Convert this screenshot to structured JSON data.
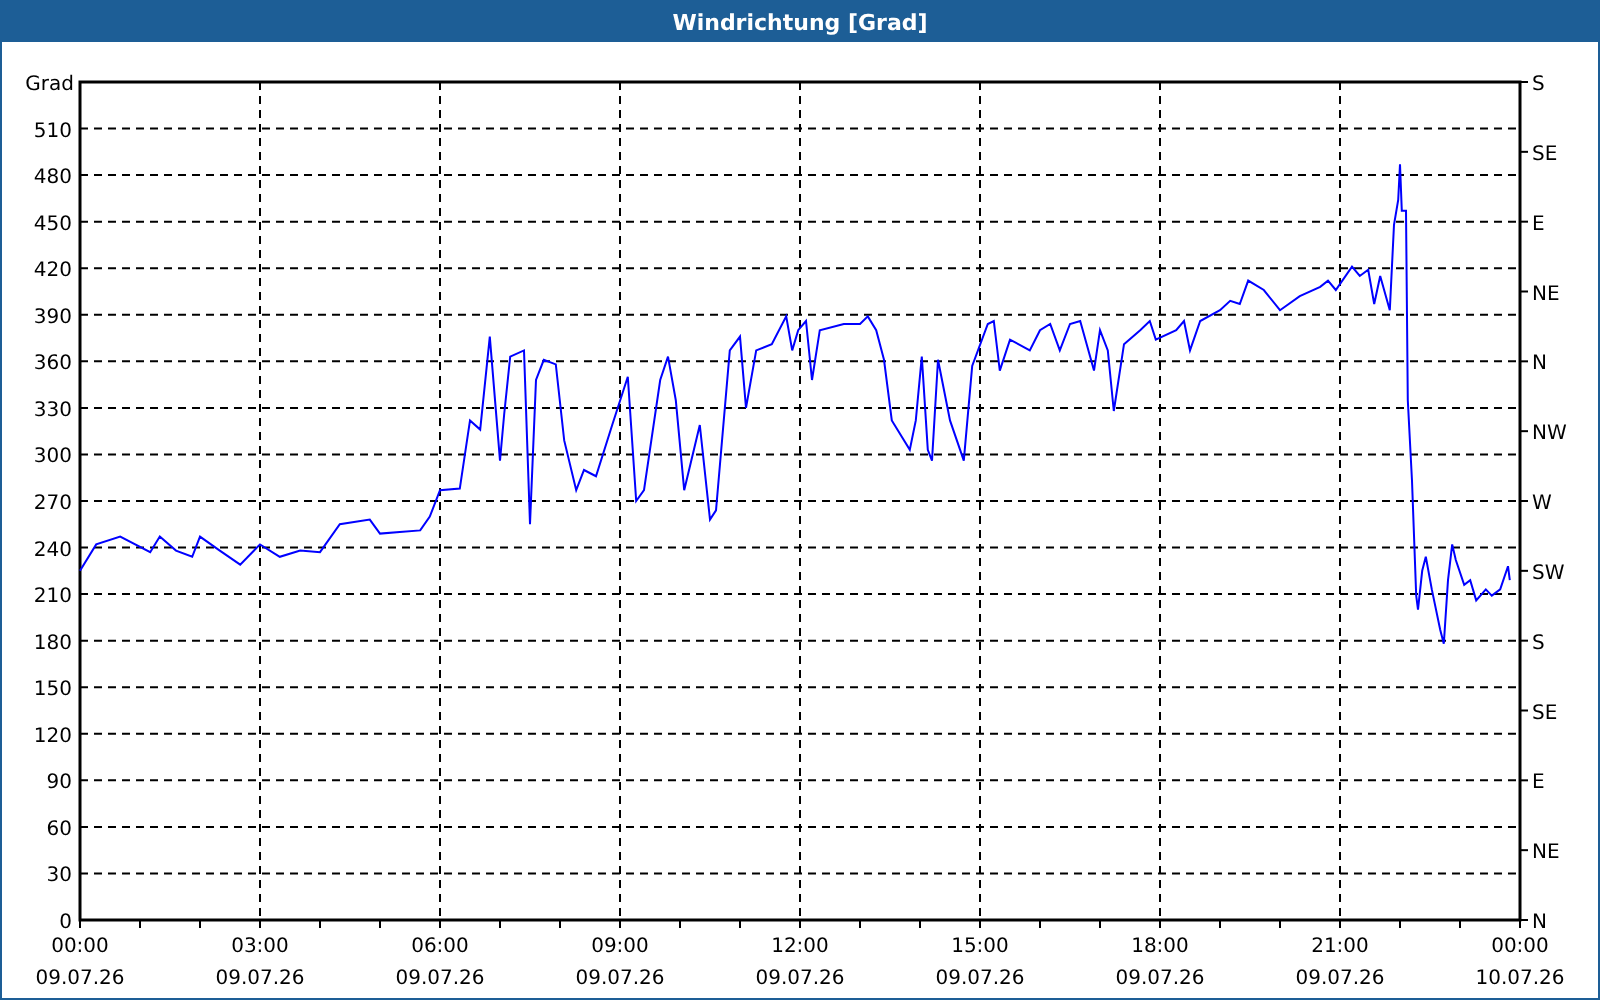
{
  "window": {
    "title": "Windrichtung [Grad]"
  },
  "chart": {
    "chart_data": {
      "type": "line",
      "grid": true,
      "ylabel": "Grad",
      "xlim": [
        0,
        24
      ],
      "ylim": [
        0,
        540
      ],
      "xticks": [
        {
          "value": 0,
          "label": "00:00"
        },
        {
          "value": 3,
          "label": "03:00"
        },
        {
          "value": 6,
          "label": "06:00"
        },
        {
          "value": 9,
          "label": "09:00"
        },
        {
          "value": 12,
          "label": "12:00"
        },
        {
          "value": 15,
          "label": "15:00"
        },
        {
          "value": 18,
          "label": "18:00"
        },
        {
          "value": 21,
          "label": "21:00"
        },
        {
          "value": 24,
          "label": "00:00"
        }
      ],
      "yticks": [
        0,
        30,
        60,
        90,
        120,
        150,
        180,
        210,
        240,
        270,
        300,
        330,
        360,
        390,
        420,
        450,
        480,
        510
      ],
      "x": [
        0,
        0.27,
        0.67,
        1.17,
        1.33,
        1.6,
        1.87,
        2.0,
        2.33,
        2.67,
        3.0,
        3.33,
        3.67,
        4.0,
        4.33,
        4.83,
        5.0,
        5.33,
        5.67,
        5.83,
        6.0,
        6.33,
        6.5,
        6.67,
        6.83,
        7.0,
        7.07,
        7.17,
        7.4,
        7.5,
        7.6,
        7.73,
        7.93,
        8.07,
        8.27,
        8.4,
        8.6,
        8.87,
        9.13,
        9.27,
        9.4,
        9.67,
        9.8,
        9.93,
        10.07,
        10.33,
        10.5,
        10.6,
        10.83,
        11.0,
        11.1,
        11.27,
        11.53,
        11.77,
        11.87,
        11.97,
        12.1,
        12.2,
        12.33,
        12.73,
        13.0,
        13.13,
        13.27,
        13.4,
        13.53,
        13.83,
        13.93,
        14.03,
        14.13,
        14.2,
        14.3,
        14.5,
        14.73,
        14.87,
        15.13,
        15.23,
        15.33,
        15.5,
        15.83,
        16.0,
        16.17,
        16.33,
        16.5,
        16.67,
        16.9,
        17.0,
        17.13,
        17.23,
        17.4,
        17.67,
        17.83,
        17.93,
        18.27,
        18.4,
        18.5,
        18.67,
        19.0,
        19.17,
        19.33,
        19.47,
        19.73,
        20.0,
        20.33,
        20.67,
        20.8,
        20.93,
        21.2,
        21.33,
        21.47,
        21.57,
        21.67,
        21.83,
        21.9,
        21.97,
        22.0,
        22.03,
        22.1,
        22.13,
        22.2,
        22.27,
        22.3,
        22.37,
        22.43,
        22.53,
        22.67,
        22.73,
        22.8,
        22.87,
        22.93,
        23.07,
        23.17,
        23.27,
        23.43,
        23.53,
        23.67,
        23.8,
        23.83
      ],
      "series": [
        {
          "color": "#0000ff",
          "values": [
            225,
            242,
            247,
            237,
            247,
            238,
            234,
            247,
            238,
            229,
            242,
            234,
            238,
            237,
            255,
            258,
            249,
            250,
            251,
            260,
            277,
            278,
            322,
            316,
            376,
            296,
            326,
            363,
            367,
            255,
            348,
            361,
            358,
            309,
            277,
            290,
            286,
            319,
            350,
            270,
            277,
            348,
            363,
            335,
            277,
            319,
            258,
            264,
            367,
            376,
            330,
            367,
            371,
            389,
            367,
            380,
            386,
            348,
            380,
            384,
            384,
            389,
            380,
            361,
            322,
            303,
            322,
            363,
            303,
            296,
            361,
            322,
            296,
            357,
            384,
            386,
            354,
            374,
            367,
            380,
            384,
            367,
            384,
            386,
            354,
            380,
            367,
            328,
            371,
            380,
            386,
            374,
            380,
            386,
            367,
            386,
            393,
            399,
            397,
            412,
            406,
            393,
            402,
            408,
            412,
            406,
            421,
            415,
            419,
            397,
            415,
            393,
            448,
            464,
            487,
            457,
            457,
            335,
            283,
            209,
            200,
            225,
            234,
            213,
            187,
            178,
            219,
            242,
            232,
            216,
            219,
            206,
            213,
            209,
            213,
            228,
            219
          ]
        }
      ]
    },
    "x_dates": [
      "09.07.26",
      "09.07.26",
      "09.07.26",
      "09.07.26",
      "09.07.26",
      "09.07.26",
      "09.07.26",
      "09.07.26",
      "10.07.26"
    ],
    "compass_ticks": [
      "S",
      "SE",
      "E",
      "NE",
      "N",
      "NW",
      "W",
      "SW",
      "S",
      "SE",
      "E",
      "NE",
      "N"
    ]
  }
}
